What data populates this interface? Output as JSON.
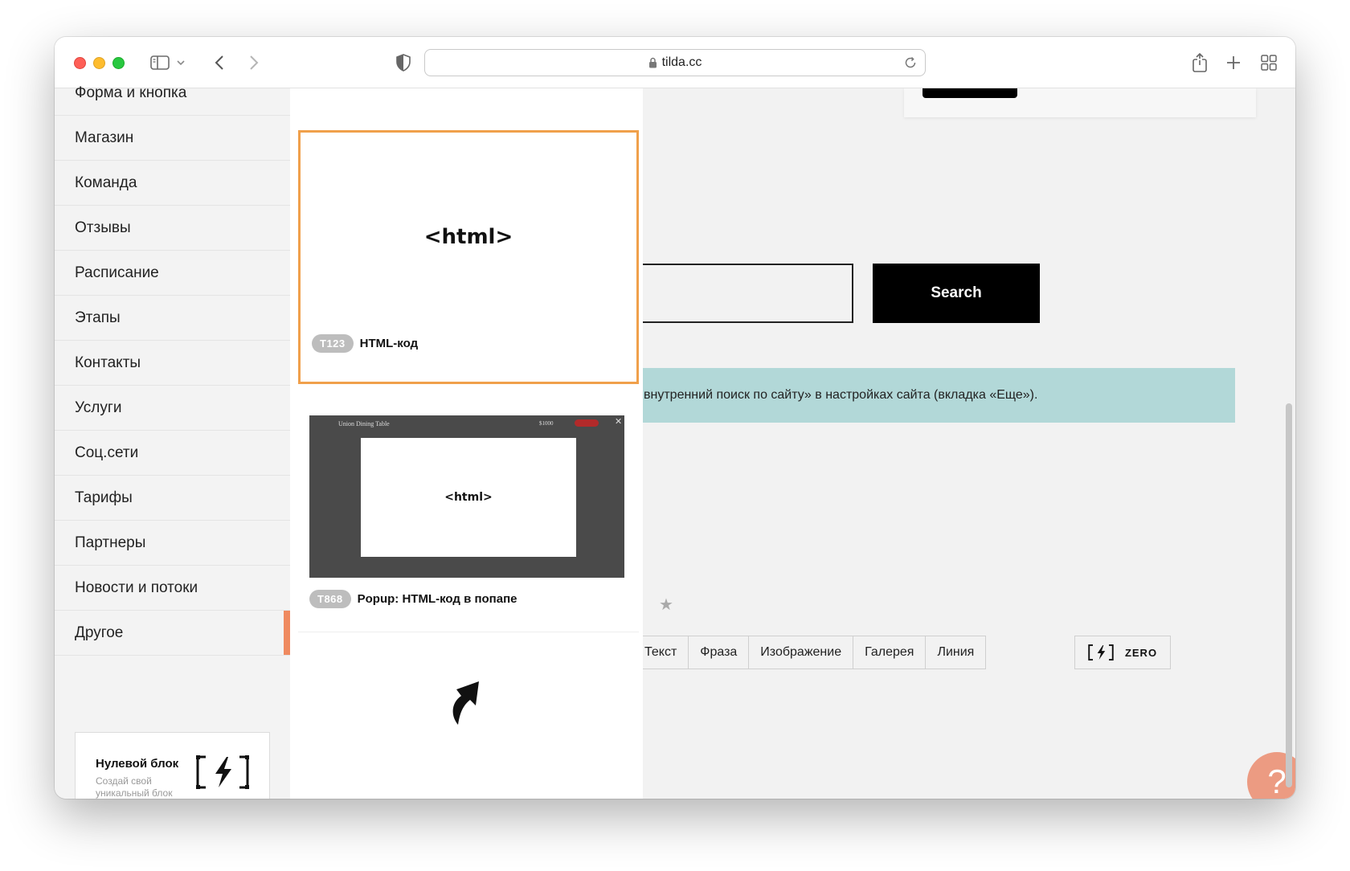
{
  "browser": {
    "url": "tilda.cc",
    "toolbar_icons": [
      "sidebar-toggle-icon",
      "chevron-down-icon",
      "back-arrow-icon",
      "forward-arrow-icon",
      "shield-icon",
      "lock-icon",
      "reload-icon",
      "share-icon",
      "plus-icon",
      "tab-overview-icon"
    ]
  },
  "sidebar": {
    "items": [
      {
        "label": "Форма и кнопка"
      },
      {
        "label": "Магазин"
      },
      {
        "label": "Команда"
      },
      {
        "label": "Отзывы"
      },
      {
        "label": "Расписание"
      },
      {
        "label": "Этапы"
      },
      {
        "label": "Контакты"
      },
      {
        "label": "Услуги"
      },
      {
        "label": "Соц.сети"
      },
      {
        "label": "Тарифы"
      },
      {
        "label": "Партнеры"
      },
      {
        "label": "Новости и потоки"
      },
      {
        "label": "Другое",
        "active": true
      }
    ],
    "zero_block": {
      "title": "Нулевой блок",
      "subtitle": "Создай свой уникальный блок",
      "icon": "lightning-frame-icon"
    },
    "accent_color": "#ef8a60"
  },
  "blocks": {
    "cards": [
      {
        "code": "T123",
        "name": "HTML-код",
        "preview_text": "<html>",
        "selected": true
      },
      {
        "code": "T868",
        "name": "Popup: HTML-код в попапе",
        "preview_text": "<html>",
        "preview_title": "Union Dining Table",
        "preview_price": "$1000",
        "selected": false
      }
    ],
    "selected_border_color": "#f0a04b"
  },
  "content": {
    "search_button": "Search",
    "notice_text": "внутренний поиск по сайту» в настройках сайта (вкладка «Еще»).",
    "notice_color": "#b2d8d8",
    "tools": [
      "Текст",
      "Фраза",
      "Изображение",
      "Галерея",
      "Линия"
    ],
    "zero_button": "ZERO",
    "help_button": "?",
    "help_color": "#ec9b82"
  }
}
